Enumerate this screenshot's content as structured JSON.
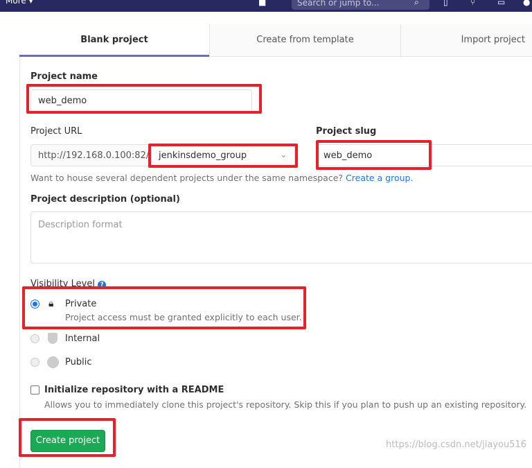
{
  "topbar": {
    "more_label": "More ▾",
    "search_placeholder": "Search or jump to..."
  },
  "tabs": [
    {
      "label": "Blank project",
      "active": true
    },
    {
      "label": "Create from template"
    },
    {
      "label": "Import project"
    }
  ],
  "form": {
    "project_name": {
      "label": "Project name",
      "value": "web_demo"
    },
    "project_url": {
      "label": "Project URL",
      "prefix": "http://192.168.0.100:82/",
      "namespace": "jenkinsdemo_group"
    },
    "project_slug": {
      "label": "Project slug",
      "value": "web_demo"
    },
    "namespace_help": "Want to house several dependent projects under the same namespace?",
    "namespace_link": "Create a group.",
    "description": {
      "label": "Project description (optional)",
      "placeholder": "Description format"
    },
    "visibility": {
      "label": "Visibility Level",
      "options": [
        {
          "label": "Private",
          "description": "Project access must be granted explicitly to each user.",
          "selected": true,
          "icon": "lock-icon"
        },
        {
          "label": "Internal",
          "icon": "shield-icon"
        },
        {
          "label": "Public",
          "icon": "globe-icon"
        }
      ]
    },
    "readme": {
      "label": "Initialize repository with a README",
      "description": "Allows you to immediately clone this project's repository. Skip this if you plan to push up an existing repository.",
      "checked": false
    },
    "submit_label": "Create project"
  },
  "watermark": "https://blog.csdn.net/jiayou516",
  "colors": {
    "nav": "#292961",
    "accent": "#6b68c7",
    "primary_button": "#1aaa55",
    "highlight": "#e8202a"
  }
}
